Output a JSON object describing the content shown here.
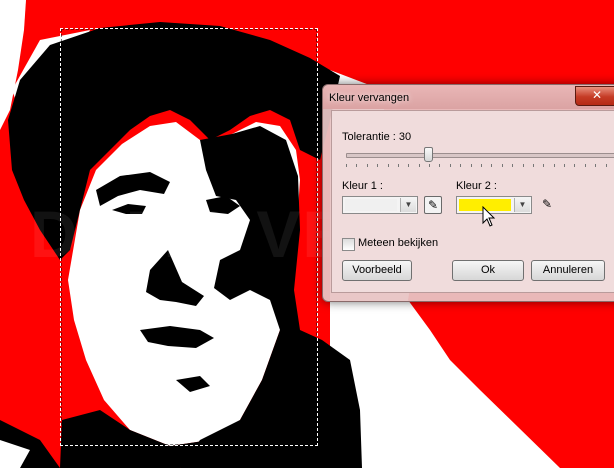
{
  "canvas": {
    "background_color": "#ff0000",
    "watermark": "DEMO VERSION"
  },
  "dialog": {
    "title": "Kleur vervangen",
    "close_icon": "close-icon",
    "tolerance_label": "Tolerantie : 30",
    "tolerance_value": 30,
    "color1_label": "Kleur 1 :",
    "color1_value": "#f0f0f0",
    "color2_label": "Kleur 2 :",
    "color2_value": "#ffee00",
    "preview_checkbox_label": "Meteen bekijken",
    "preview_checked": false,
    "buttons": {
      "preview": "Voorbeeld",
      "ok": "Ok",
      "cancel": "Annuleren"
    }
  }
}
